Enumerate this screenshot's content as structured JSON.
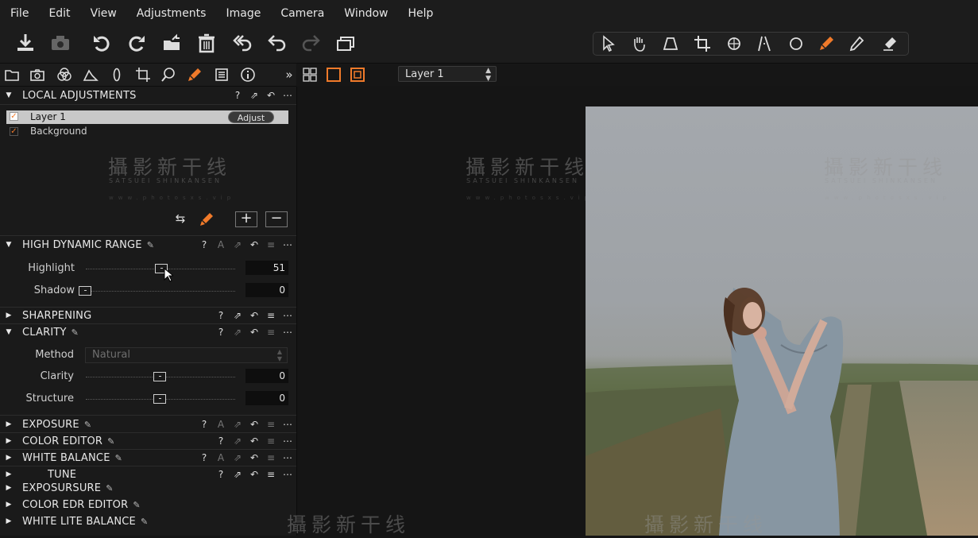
{
  "menu": [
    "File",
    "Edit",
    "View",
    "Adjustments",
    "Image",
    "Camera",
    "Window",
    "Help"
  ],
  "toolbar": {
    "left_icons": [
      "import-icon",
      "camera-icon",
      "rotate-left-icon",
      "rotate-right-icon",
      "export-icon",
      "trash-icon",
      "undo-all-icon",
      "undo-icon",
      "redo-icon",
      "variants-icon"
    ],
    "cursor_tools": [
      "pointer-icon",
      "hand-icon",
      "keystone-icon",
      "crop-icon",
      "rotate-tool-icon",
      "straighten-icon",
      "spot-icon",
      "brush-icon",
      "picker-icon",
      "eraser-icon"
    ]
  },
  "tool_tabs": [
    "library-tab",
    "capture-tab",
    "color-tab",
    "lens-tab",
    "exposure-tab",
    "crop-tab",
    "search-tab",
    "local-adjust-tab",
    "metadata-tab",
    "info-tab"
  ],
  "viewer": {
    "layer_select": "Layer 1"
  },
  "local_adjustments": {
    "title": "LOCAL ADJUSTMENTS",
    "layers": [
      {
        "name": "Layer 1",
        "selected": true,
        "checked": true
      },
      {
        "name": "Background",
        "selected": false,
        "checked": true
      }
    ],
    "adjust_label": "Adjust"
  },
  "hdr": {
    "title": "HIGH DYNAMIC RANGE",
    "highlight_label": "Highlight",
    "highlight_value": "51",
    "shadow_label": "Shadow",
    "shadow_value": "0"
  },
  "sharpening": {
    "title": "SHARPENING"
  },
  "clarity": {
    "title": "CLARITY",
    "method_label": "Method",
    "method_value": "Natural",
    "clarity_label": "Clarity",
    "clarity_value": "0",
    "structure_label": "Structure",
    "structure_value": "0"
  },
  "sections_collapsed": [
    {
      "title": "EXPOSURE"
    },
    {
      "title": "COLOR EDITOR"
    },
    {
      "title": "WHITE BALANCE"
    },
    {
      "title": "TUNE"
    }
  ],
  "ghost_sections": [
    "EXPOSURSURE",
    "COLOR EDR EDITOR",
    "WHITE LITE BALANCE"
  ],
  "watermark": {
    "cn": "攝影新干线",
    "en": "SATSUEI SHINKANSEN",
    "url": "www.photosxs.vip"
  },
  "colors": {
    "accent": "#f07a2a",
    "panel": "#1a1a1a",
    "viewer": "#151515"
  }
}
